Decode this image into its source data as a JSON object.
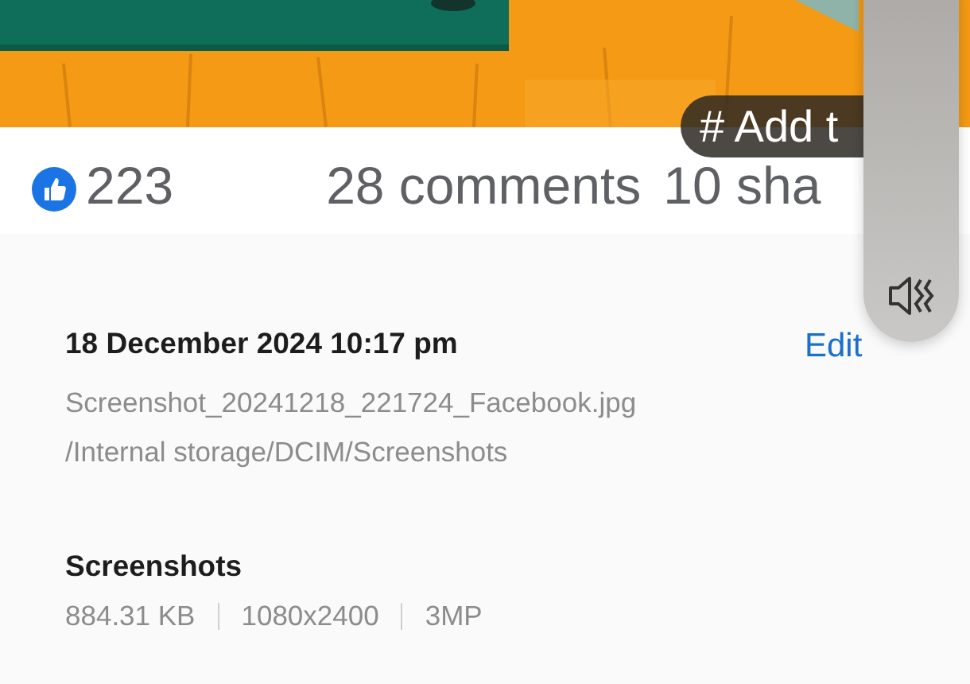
{
  "stats": {
    "likes": "223",
    "comments": "28 comments",
    "shares": "10 sha"
  },
  "tag_button": {
    "label": "# Add t"
  },
  "details": {
    "date": "18 December 2024 10:17 pm",
    "edit": "Edit",
    "filename": "Screenshot_20241218_221724_Facebook.jpg",
    "path": "/Internal storage/DCIM/Screenshots"
  },
  "album": {
    "name": "Screenshots",
    "info": [
      "884.31 KB",
      "1080x2400",
      "3MP"
    ]
  },
  "volume": {
    "muted": true,
    "level": 0
  }
}
